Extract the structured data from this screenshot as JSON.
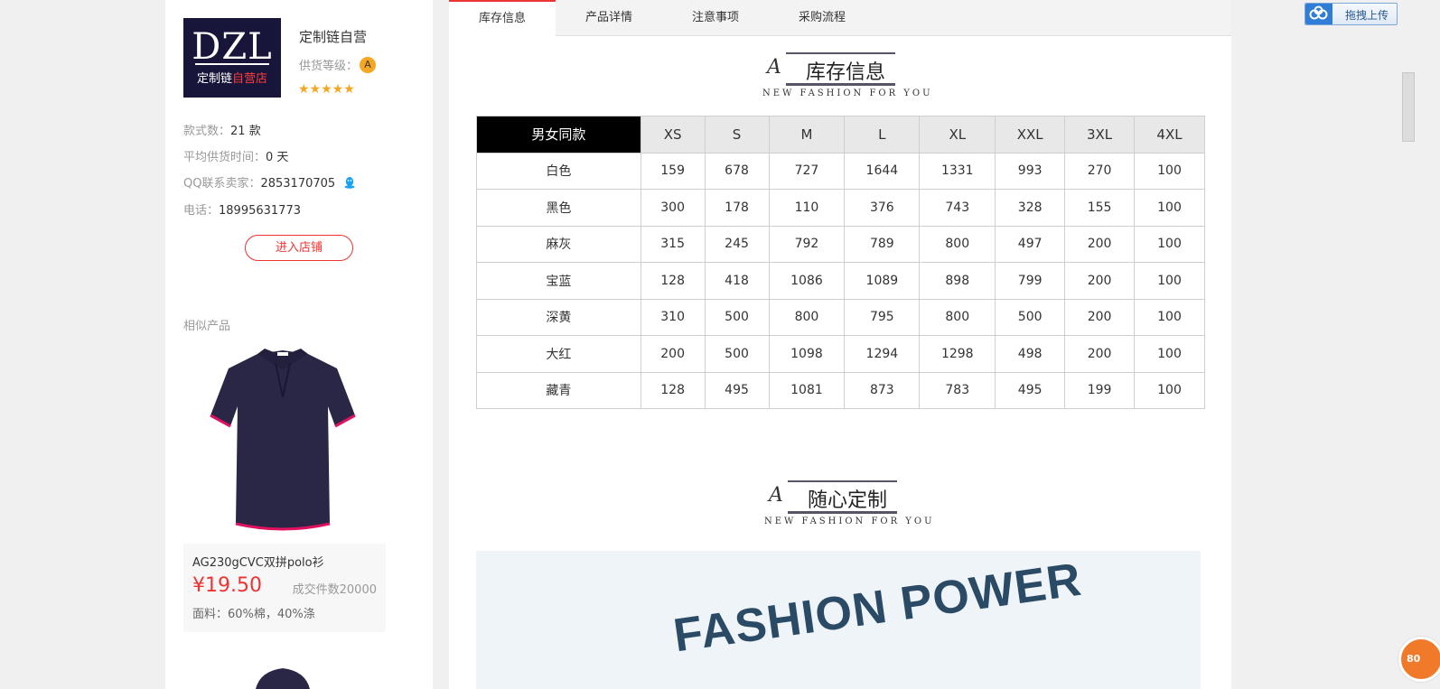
{
  "shop": {
    "logo_big": "DZL",
    "logo_small_a": "定制链",
    "logo_small_b": "自营店",
    "name": "定制链自营",
    "grade_label": "供货等级：",
    "grade_value": "A",
    "stars": "★★★★★",
    "styles_label": "款式数：",
    "styles_value": "21 款",
    "avg_time_label": "平均供货时间：",
    "avg_time_value": "0 天",
    "qq_label": "QQ联系卖家：",
    "qq_value": "2853170705",
    "phone_label": "电话：",
    "phone_value": "18995631773",
    "enter_button": "进入店铺"
  },
  "similar": {
    "title": "相似产品",
    "product": {
      "name": "AG230gCVC双拼polo衫",
      "price": "¥19.50",
      "sold": "成交件数20000",
      "material": "面料：60%棉，40%涤"
    }
  },
  "tabs": [
    "库存信息",
    "产品详情",
    "注意事项",
    "采购流程"
  ],
  "section1": {
    "script": "A",
    "title": "库存信息",
    "en": "NEW FASHION FOR YOU"
  },
  "section2": {
    "script": "A",
    "title": "随心定制",
    "en": "NEW FASHION FOR YOU"
  },
  "stock_table": {
    "corner": "男女同款",
    "sizes": [
      "XS",
      "S",
      "M",
      "L",
      "XL",
      "XXL",
      "3XL",
      "4XL"
    ],
    "rows": [
      {
        "color": "白色",
        "values": [
          "159",
          "678",
          "727",
          "1644",
          "1331",
          "993",
          "270",
          "100"
        ]
      },
      {
        "color": "黑色",
        "values": [
          "300",
          "178",
          "110",
          "376",
          "743",
          "328",
          "155",
          "100"
        ]
      },
      {
        "color": "麻灰",
        "values": [
          "315",
          "245",
          "792",
          "789",
          "800",
          "497",
          "200",
          "100"
        ]
      },
      {
        "color": "宝蓝",
        "values": [
          "128",
          "418",
          "1086",
          "1089",
          "898",
          "799",
          "200",
          "100"
        ]
      },
      {
        "color": "深黄",
        "values": [
          "310",
          "500",
          "800",
          "795",
          "800",
          "500",
          "200",
          "100"
        ]
      },
      {
        "color": "大红",
        "values": [
          "200",
          "500",
          "1098",
          "1294",
          "1298",
          "498",
          "200",
          "100"
        ]
      },
      {
        "color": "藏青",
        "values": [
          "128",
          "495",
          "1081",
          "873",
          "783",
          "495",
          "199",
          "100"
        ]
      }
    ]
  },
  "banner": {
    "text": "FASHION POWER"
  },
  "toolbar": {
    "upload_label": "拖拽上传",
    "corner_badge": "80"
  },
  "colors": {
    "accent": "#e33333",
    "star": "#f5a623",
    "shirt": "#2a2646",
    "header_black": "#000000"
  }
}
